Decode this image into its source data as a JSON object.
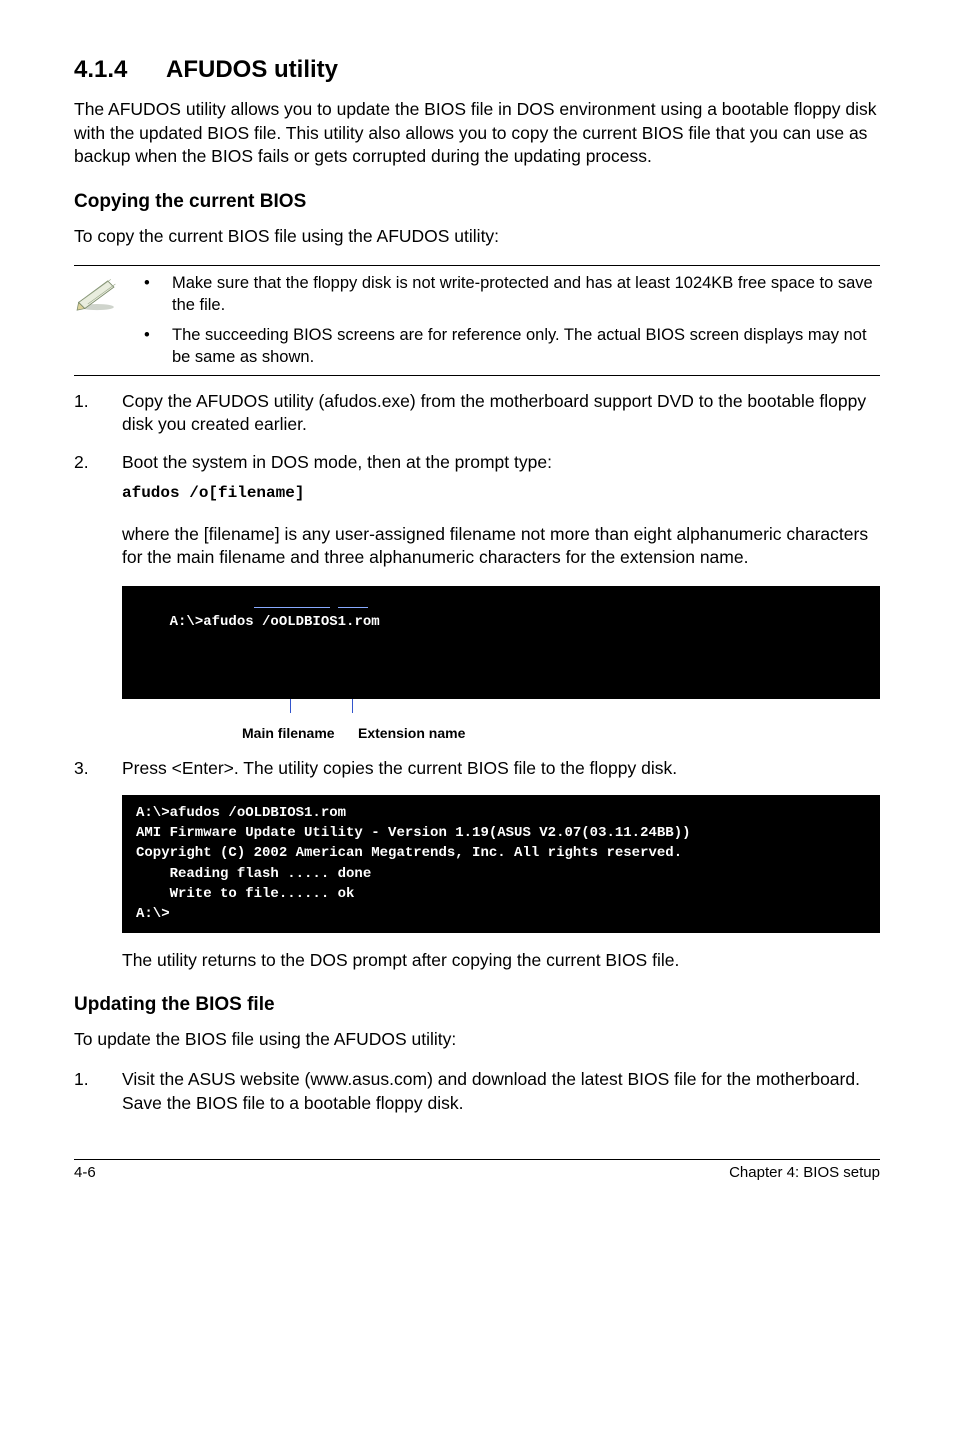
{
  "section": {
    "number": "4.1.4",
    "title": "AFUDOS utility"
  },
  "intro": "The AFUDOS utility allows you to update the BIOS file in DOS environment using a bootable floppy disk with the updated BIOS file. This utility also allows you to copy the current BIOS file that you can use as backup when the BIOS fails or gets corrupted during the updating process.",
  "copy_heading": "Copying the current BIOS",
  "copy_leadin": "To copy the current BIOS file using the AFUDOS utility:",
  "notes": {
    "a": "Make sure that the floppy disk is not write-protected and has at least 1024KB free space to save the file.",
    "b": "The succeeding BIOS screens are for reference only. The actual BIOS screen displays may not be same as shown."
  },
  "steps_copy": {
    "s1": {
      "num": "1.",
      "text": "Copy the AFUDOS utility (afudos.exe) from the motherboard support DVD to the bootable floppy disk you created earlier."
    },
    "s2": {
      "num": "2.",
      "text": "Boot the system in DOS mode, then at the prompt type:",
      "code": "afudos /o[filename]"
    },
    "s2_explain": "where the [filename] is any user-assigned filename not more than eight alphanumeric characters  for the main filename and three alphanumeric characters for the extension name.",
    "term1": "A:\\>afudos /oOLDBIOS1.rom",
    "annot": {
      "main": "Main filename",
      "ext": "Extension name"
    },
    "s3": {
      "num": "3.",
      "text": "Press <Enter>. The utility copies the current BIOS file to the floppy disk."
    },
    "term2": "A:\\>afudos /oOLDBIOS1.rom\nAMI Firmware Update Utility - Version 1.19(ASUS V2.07(03.11.24BB))\nCopyright (C) 2002 American Megatrends, Inc. All rights reserved.\n    Reading flash ..... done\n    Write to file...... ok\nA:\\>",
    "after": "The utility returns to the DOS prompt after copying the current BIOS file."
  },
  "update_heading": "Updating the BIOS file",
  "update_leadin": "To update the BIOS file using the AFUDOS utility:",
  "steps_update": {
    "s1": {
      "num": "1.",
      "text": "Visit the ASUS website (www.asus.com) and download the latest BIOS file for the motherboard. Save the BIOS file to a bootable floppy disk."
    }
  },
  "footer": {
    "left": "4-6",
    "right": "Chapter 4: BIOS setup"
  }
}
